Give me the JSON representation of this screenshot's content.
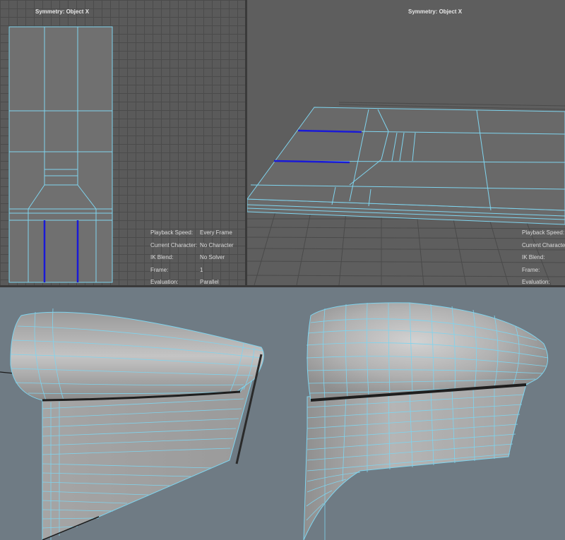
{
  "viewports": {
    "top_left": {
      "title": "Symmetry: Object X"
    },
    "top_right": {
      "title": "Symmetry: Object X"
    }
  },
  "hud": {
    "top_left": [
      {
        "label": "Playback Speed:",
        "value": "Every Frame"
      },
      {
        "label": "Current Character:",
        "value": "No Character"
      },
      {
        "label": "IK Blend:",
        "value": "No Solver"
      },
      {
        "label": "Frame:",
        "value": "1"
      },
      {
        "label": "Evaluation:",
        "value": "Parallel"
      }
    ],
    "top_right": [
      {
        "label": "Playback Speed:"
      },
      {
        "label": "Current Character:"
      },
      {
        "label": "IK Blend:"
      },
      {
        "label": "Frame:"
      },
      {
        "label": "Evaluation:"
      }
    ]
  },
  "colors": {
    "wireframe": "#7fd4ee",
    "selected_edge": "#1a1ad6",
    "viewport_bg": "#5a5a5a",
    "render_bg": "#6f7b84"
  },
  "icons": {
    "mesh_front": "wireframe-mesh-front",
    "mesh_perspective": "wireframe-mesh-perspective",
    "mesh_side_render": "rendered-mesh-side",
    "mesh_three_quarter_render": "rendered-mesh-three-quarter"
  }
}
